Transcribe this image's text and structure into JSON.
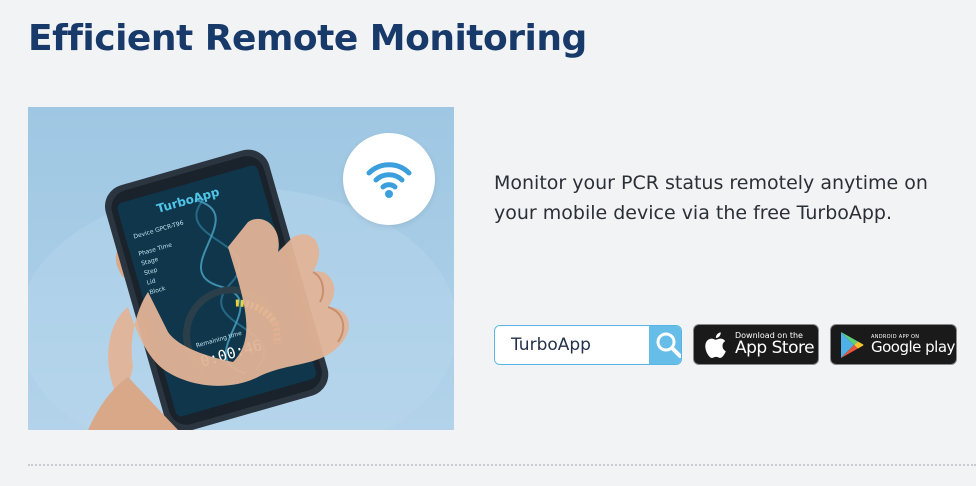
{
  "heading": "Efficient Remote Monitoring",
  "description": "Monitor your PCR status remotely anytime on your mobile device via the free TurboApp.",
  "hero": {
    "phone_brand": "TurboApp",
    "remaining_label": "Remaining time",
    "remaining_time": "0:00:46",
    "wifi_icon": "wifi-icon"
  },
  "search": {
    "value": "TurboApp",
    "icon": "search-icon"
  },
  "app_store": {
    "small_text": "Download on the",
    "big_text": "App Store",
    "icon": "apple-icon"
  },
  "google_play": {
    "small_text": "ANDROID APP ON",
    "big_text": "Google play",
    "icon": "play-icon"
  },
  "colors": {
    "heading": "#173a6b",
    "accent": "#66bde8",
    "background": "#f2f3f5"
  }
}
